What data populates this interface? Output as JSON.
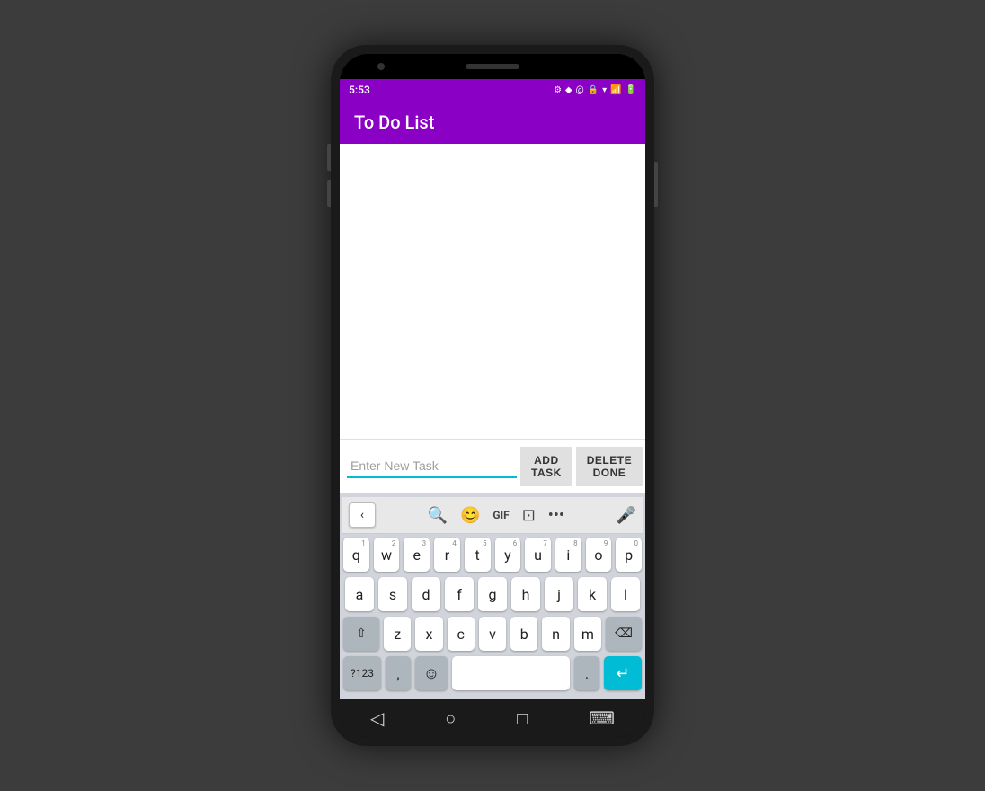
{
  "statusBar": {
    "time": "5:53",
    "icons": [
      "⚙",
      "◆",
      "✉",
      "🔋"
    ]
  },
  "appBar": {
    "title": "To Do List"
  },
  "inputRow": {
    "placeholder": "Enter New Task",
    "addTaskLabel": "ADD TASK",
    "deleteDoneLabel": "DELETE DONE"
  },
  "keyboard": {
    "row1": [
      {
        "label": "q",
        "num": "1"
      },
      {
        "label": "w",
        "num": "2"
      },
      {
        "label": "e",
        "num": "3"
      },
      {
        "label": "r",
        "num": "4"
      },
      {
        "label": "t",
        "num": "5"
      },
      {
        "label": "y",
        "num": "6"
      },
      {
        "label": "u",
        "num": "7"
      },
      {
        "label": "i",
        "num": "8"
      },
      {
        "label": "o",
        "num": "9"
      },
      {
        "label": "p",
        "num": "0"
      }
    ],
    "row2": [
      {
        "label": "a"
      },
      {
        "label": "s"
      },
      {
        "label": "d"
      },
      {
        "label": "f"
      },
      {
        "label": "g"
      },
      {
        "label": "h"
      },
      {
        "label": "j"
      },
      {
        "label": "k"
      },
      {
        "label": "l"
      }
    ],
    "row3": [
      {
        "label": "z"
      },
      {
        "label": "x"
      },
      {
        "label": "c"
      },
      {
        "label": "v"
      },
      {
        "label": "b"
      },
      {
        "label": "n"
      },
      {
        "label": "m"
      }
    ],
    "numToggle": "?123",
    "comma": ",",
    "period": ".",
    "enterArrow": "↵"
  }
}
